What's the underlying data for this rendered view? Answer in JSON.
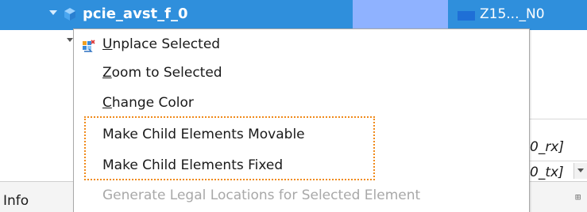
{
  "tree": {
    "selected_row": {
      "name": "pcie_avst_f_0",
      "part": "Z15..._N0",
      "color_hex": "#8fb2ff",
      "swatch_hex": "#1f6fd6"
    }
  },
  "background": {
    "right_text_1": "0_rx]",
    "right_text_2": "0_tx]"
  },
  "info_bar": {
    "label": "Info"
  },
  "context_menu": {
    "items": [
      {
        "key": "unplace",
        "label": "Unplace Selected",
        "underline": "U",
        "rest": "nplace Selected",
        "enabled": true,
        "icon": "unplace-icon"
      },
      {
        "key": "zoom",
        "label": "Zoom to Selected",
        "underline": "Z",
        "rest": "oom to Selected",
        "enabled": true
      },
      {
        "key": "color",
        "label": "Change Color",
        "underline": "C",
        "rest": "hange Color",
        "enabled": true
      },
      {
        "key": "movable",
        "label": "Make Child Elements Movable",
        "enabled": true
      },
      {
        "key": "fixed",
        "label": "Make Child Elements Fixed",
        "enabled": true
      },
      {
        "key": "generate",
        "label": "Generate Legal Locations for Selected Element",
        "enabled": false
      }
    ],
    "highlight_color": "#f08a1a"
  }
}
